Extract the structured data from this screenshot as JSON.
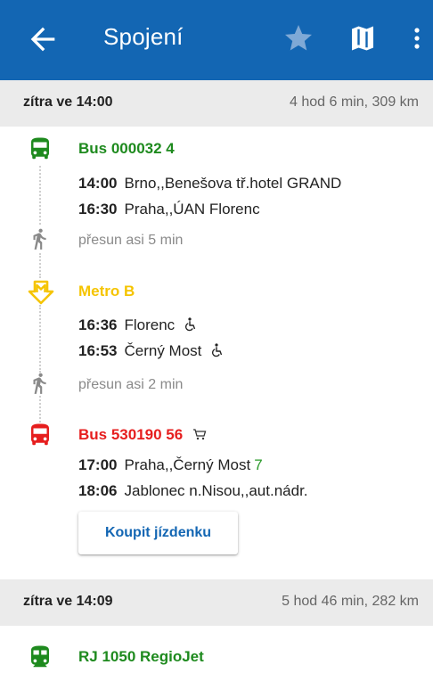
{
  "appbar": {
    "title": "Spojení",
    "bg_color": "#1366b3",
    "icons": [
      "back-arrow-icon",
      "star-icon",
      "map-icon",
      "more-vert-icon"
    ]
  },
  "connections": [
    {
      "when": "zítra ve 14:00",
      "duration": "4 hod 6 min, 309 km",
      "legs": [
        {
          "type": "bus",
          "name": "Bus 000032 4",
          "color": "#1e8a1e",
          "stops": [
            {
              "time": "14:00",
              "place": "Brno,,Benešova tř.hotel GRAND"
            },
            {
              "time": "16:30",
              "place": "Praha,,ÚAN Florenc"
            }
          ]
        },
        {
          "type": "walk",
          "text": "přesun asi 5 min"
        },
        {
          "type": "metro",
          "name": "Metro B",
          "color": "#f5c400",
          "stops": [
            {
              "time": "16:36",
              "place": "Florenc",
              "accessible": true
            },
            {
              "time": "16:53",
              "place": "Černý Most",
              "accessible": true
            }
          ]
        },
        {
          "type": "walk",
          "text": "přesun asi 2 min"
        },
        {
          "type": "bus",
          "name": "Bus 530190 56",
          "color": "#e61e1e",
          "has_cart": true,
          "stops": [
            {
              "time": "17:00",
              "place": "Praha,,Černý Most",
              "platform": "7"
            },
            {
              "time": "18:06",
              "place": "Jablonec n.Nisou,,aut.nádr."
            }
          ]
        }
      ],
      "buy_label": "Koupit jízdenku"
    },
    {
      "when": "zítra ve 14:09",
      "duration": "5 hod 46 min, 282 km",
      "legs": [
        {
          "type": "train",
          "name": "RJ 1050 RegioJet",
          "color": "#1e8a1e"
        }
      ]
    }
  ]
}
